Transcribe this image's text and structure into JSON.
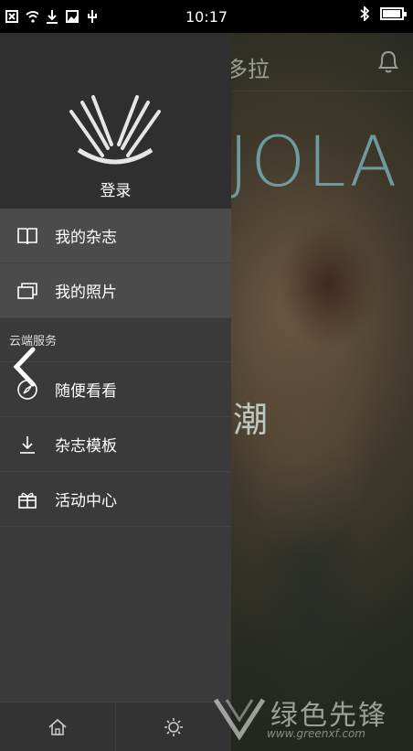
{
  "status_bar": {
    "time": "10:17",
    "left_icons": [
      "close-box-icon",
      "wifi-icon",
      "download-icon",
      "image-icon",
      "usb-icon"
    ],
    "right_icons": [
      "bluetooth-icon",
      "battery-icon"
    ],
    "battery_level": 0.95
  },
  "background": {
    "title": "多拉",
    "logo_text": "JOLA",
    "headline_char": "潮"
  },
  "drawer": {
    "login_label": "登录",
    "items": [
      {
        "label": "我的杂志",
        "icon": "book-icon",
        "active": true
      },
      {
        "label": "我的照片",
        "icon": "photos-icon",
        "active": true
      }
    ],
    "section_title": "云端服务",
    "service_items": [
      {
        "label": "随便看看",
        "icon": "compass-icon"
      },
      {
        "label": "杂志模板",
        "icon": "download-icon"
      },
      {
        "label": "活动中心",
        "icon": "gift-icon"
      }
    ],
    "bottom_icons": [
      "home-icon",
      "settings-icon"
    ]
  },
  "watermark": {
    "text": "绿色先锋",
    "url": "www.greenxf.com"
  },
  "colors": {
    "drawer_bg": "#3a3a3a",
    "drawer_header_bg": "#2f2f2f",
    "active_item_bg": "#4b4b4b",
    "logo_accent": "#7aaaaf"
  }
}
